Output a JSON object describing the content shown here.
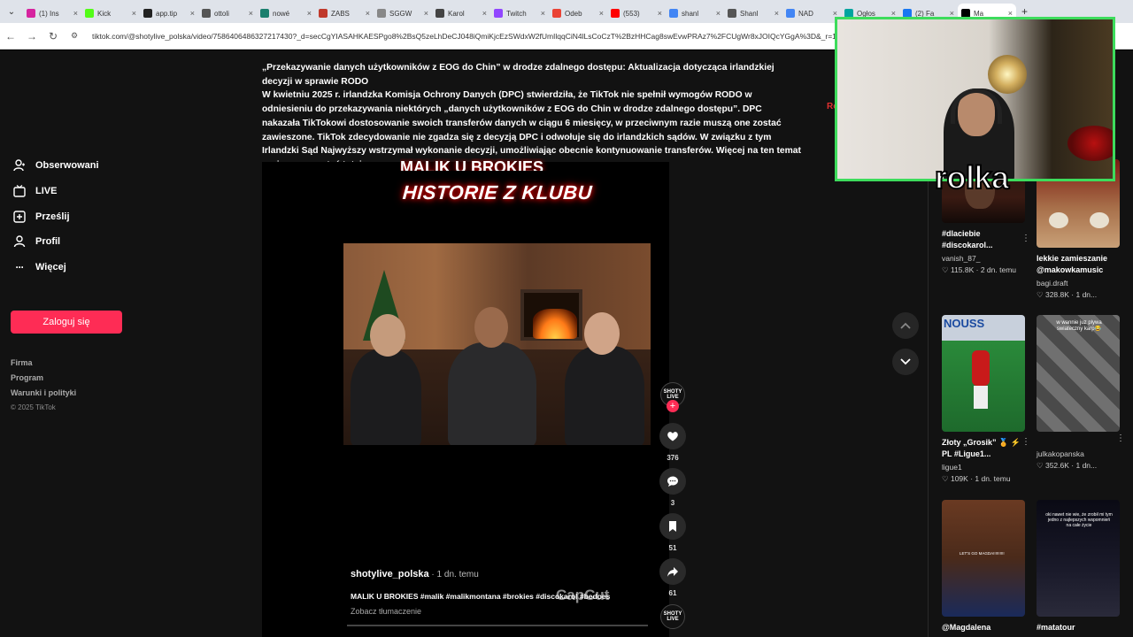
{
  "browser": {
    "tabs": [
      {
        "label": "(1) Ins",
        "color": "#d6249f"
      },
      {
        "label": "Kick",
        "color": "#53fc18"
      },
      {
        "label": "app.tip",
        "color": "#222222"
      },
      {
        "label": "ottoli",
        "color": "#555555"
      },
      {
        "label": "nowé",
        "color": "#1a7f6e"
      },
      {
        "label": "ZABS",
        "color": "#c0392b"
      },
      {
        "label": "SGGW",
        "color": "#888888"
      },
      {
        "label": "Karol",
        "color": "#444444"
      },
      {
        "label": "Twitch",
        "color": "#9146ff"
      },
      {
        "label": "Odeb",
        "color": "#ea4335"
      },
      {
        "label": "(553)",
        "color": "#ff0000"
      },
      {
        "label": "shanl",
        "color": "#4285f4"
      },
      {
        "label": "Shanl",
        "color": "#555555"
      },
      {
        "label": "NAD",
        "color": "#4285f4"
      },
      {
        "label": "Ogłos",
        "color": "#00a49f"
      },
      {
        "label": "(2) Fa",
        "color": "#1877f2"
      },
      {
        "label": "Ma",
        "color": "#000000"
      }
    ],
    "new_tab": "+",
    "url": "tiktok.com/@shotylive_polska/video/7586406486327217430?_d=secCgYIASAHKAESPgo8%2BsQ5zeLhDeCJ048iQmiKjcEzSWdxW2fUmIlqqCiN4lLsCoCzT%2BzHHCag8swEvwPRAz7%2FCUgWr8xJOIQcYGgA%3D&_r=1&_svg"
  },
  "sidebar": {
    "items": [
      {
        "label": "Obserwowani",
        "icon": "person-follow-icon"
      },
      {
        "label": "LIVE",
        "icon": "live-tv-icon"
      },
      {
        "label": "Prześlij",
        "icon": "upload-plus-icon"
      },
      {
        "label": "Profil",
        "icon": "profile-icon"
      },
      {
        "label": "Więcej",
        "icon": "more-dots-icon"
      }
    ],
    "login": "Zaloguj się",
    "footer": [
      "Firma",
      "Program",
      "Warunki i polityki"
    ],
    "copyright": "© 2025 TikTok"
  },
  "notice": {
    "title": "„Przekazywanie danych użytkowników z EOG do Chin” w drodze zdalnego dostępu: Aktualizacja dotycząca irlandzkiej decyzji w sprawie RODO",
    "body": "W kwietniu 2025 r. irlandzka Komisja Ochrony Danych (DPC) stwierdziła, że TikTok nie spełnił wymogów RODO w odniesieniu do przekazywania niektórych „danych użytkowników z EOG do Chin w drodze zdalnego dostępu”. DPC nakazała TikTokowi dostosowanie swoich transferów danych w ciągu 6 miesięcy, w przeciwnym razie muszą one zostać zawieszone. TikTok zdecydowanie nie zgadza się z decyzją DPC i odwołuje się do irlandzkich sądów. W związku z tym Irlandzki Sąd Najwyższy wstrzymał wykonanie decyzji, umożliwiając obecnie kontynuowanie transferów. Więcej na ten temat można przeczytać tutaj."
  },
  "video": {
    "banner": "HISTORIE Z KLUBU",
    "author": "shotylive_polska",
    "time": " · 1 dn. temu",
    "caption": "MALIK U BROKIES #malik #malikmontana #brokies #discokarol #bedoes",
    "translate": "Zobacz tłumaczenie",
    "watermark": "CapCut",
    "avatar_text": "SHOTY LIVE",
    "likes": "376",
    "comments": "3",
    "saves": "51",
    "shares": "61"
  },
  "red_text": "Ro",
  "recommended": [
    {
      "title": "#dlaciebie #discokarol...",
      "user": "vanish_87_",
      "stats": "♡ 115.8K · 2 dn. temu",
      "thumb": "#3a1a12"
    },
    {
      "title": "lekkie zamieszanie @makowkamusic",
      "user": "bagi.draft",
      "stats": "♡ 328.8K · 1 dn...",
      "thumb": "#8a2a1a"
    },
    {
      "title": "Złoty „Grosik” 🏅 ⚡ PL #Ligue1...",
      "user": "ligue1",
      "stats": "♡ 109K · 1 dn. temu",
      "thumb": "#2a7a3a"
    },
    {
      "title": "",
      "user": "julkakopanska",
      "stats": "♡ 352.6K · 1 dn...",
      "thumb": "#6a6a6a"
    },
    {
      "title": "@Magdalena",
      "user": "",
      "stats": "",
      "thumb": "#4a2a1a"
    },
    {
      "title": "#matatour",
      "user": "",
      "stats": "",
      "thumb": "#1a1a2a"
    }
  ],
  "thumb_texts": {
    "nouss": "NOUSS",
    "karp": "w wannie juz plywa swiateczny karp😂",
    "memory": "oki nawet nie wie, że zrobił mi tym jedno z najlepszych wspomnień na całe życie",
    "lets_go": "LET'S GO MAGDA!!!!!!!!!!"
  },
  "webcam": {
    "label": "rolka",
    "border_color": "#3ddc5c"
  }
}
